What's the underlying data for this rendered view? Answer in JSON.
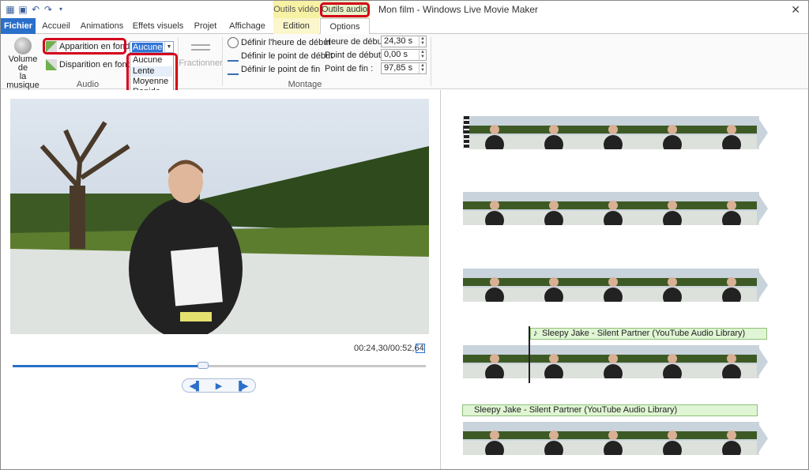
{
  "window": {
    "title": "Mon film - Windows Live Movie Maker",
    "contextual_tabs": {
      "video": "Outils vidéo",
      "audio": "Outils audio"
    }
  },
  "quick_access_icons": [
    "app-icon",
    "save-icon",
    "undo-icon",
    "redo-icon",
    "customize-icon"
  ],
  "tabs": [
    {
      "label": "Fichier"
    },
    {
      "label": "Accueil"
    },
    {
      "label": "Animations"
    },
    {
      "label": "Effets visuels"
    },
    {
      "label": "Projet"
    },
    {
      "label": "Affichage"
    },
    {
      "label": "Edition"
    },
    {
      "label": "Options"
    }
  ],
  "ribbon": {
    "audio_group": {
      "label": "Audio",
      "volume_label_1": "Volume de",
      "volume_label_2": "la musique",
      "fade_in": "Apparition en fondu",
      "fade_out": "Disparition en fondu",
      "fade_value": "Aucune",
      "fade_options": [
        "Aucune",
        "Lente",
        "Moyenne",
        "Rapide"
      ]
    },
    "split": "Fractionner",
    "editing_group": {
      "label": "Montage",
      "set_start_time": "Définir l'heure de début",
      "set_start_point": "Définir le point de début",
      "set_end_point": "Définir le point de fin",
      "start_time_label": "Heure de début :",
      "start_time_value": "24,30 s",
      "start_point_label": "Point de début :",
      "start_point_value": "0,00 s",
      "end_point_label": "Point de fin :",
      "end_point_value": "97,85 s"
    }
  },
  "preview": {
    "timecode": "00:24,30/00:52,64",
    "progress": 0.46
  },
  "storyboard": {
    "audio_clips": [
      "Sleepy Jake - Silent Partner (YouTube Audio Library)",
      "Sleepy Jake - Silent Partner (YouTube Audio Library)"
    ]
  },
  "colors": {
    "accent": "#2a6fc9",
    "highlight": "#d4001b",
    "audio_ctx": "#eaf3c8",
    "video_ctx": "#f7f1a3"
  }
}
